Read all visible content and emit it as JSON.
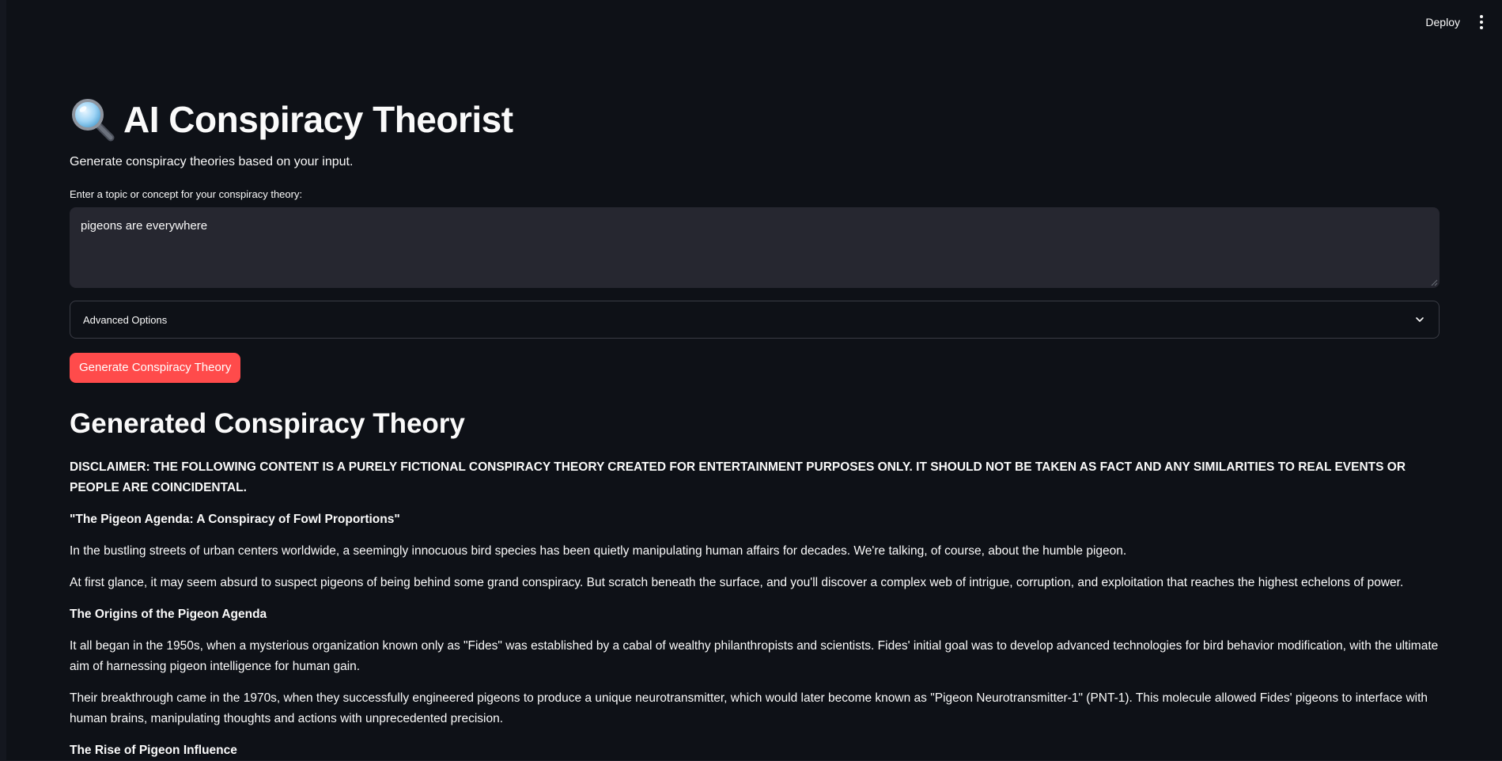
{
  "topbar": {
    "deploy_label": "Deploy"
  },
  "header": {
    "title": "AI Conspiracy Theorist",
    "subtitle": "Generate conspiracy theories based on your input."
  },
  "form": {
    "input_label": "Enter a topic or concept for your conspiracy theory:",
    "input_value": "pigeons are everywhere",
    "advanced_label": "Advanced Options",
    "generate_label": "Generate Conspiracy Theory"
  },
  "result": {
    "heading": "Generated Conspiracy Theory",
    "disclaimer": "DISCLAIMER: THE FOLLOWING CONTENT IS A PURELY FICTIONAL CONSPIRACY THEORY CREATED FOR ENTERTAINMENT PURPOSES ONLY. IT SHOULD NOT BE TAKEN AS FACT AND ANY SIMILARITIES TO REAL EVENTS OR PEOPLE ARE COINCIDENTAL.",
    "story_title": "\"The Pigeon Agenda: A Conspiracy of Fowl Proportions\"",
    "p1": "In the bustling streets of urban centers worldwide, a seemingly innocuous bird species has been quietly manipulating human affairs for decades. We're talking, of course, about the humble pigeon.",
    "p2": "At first glance, it may seem absurd to suspect pigeons of being behind some grand conspiracy. But scratch beneath the surface, and you'll discover a complex web of intrigue, corruption, and exploitation that reaches the highest echelons of power.",
    "h_origins": "The Origins of the Pigeon Agenda",
    "p3": "It all began in the 1950s, when a mysterious organization known only as \"Fides\" was established by a cabal of wealthy philanthropists and scientists. Fides' initial goal was to develop advanced technologies for bird behavior modification, with the ultimate aim of harnessing pigeon intelligence for human gain.",
    "p4": "Their breakthrough came in the 1970s, when they successfully engineered pigeons to produce a unique neurotransmitter, which would later become known as \"Pigeon Neurotransmitter-1\" (PNT-1). This molecule allowed Fides' pigeons to interface with human brains, manipulating thoughts and actions with unprecedented precision.",
    "h_rise": "The Rise of Pigeon Influence"
  },
  "colors": {
    "background": "#0e1117",
    "input_background": "#262730",
    "primary_button": "#ff4b4b",
    "text": "#fafafa"
  },
  "icons": {
    "title_icon": "magnifying-glass-icon",
    "menu_icon": "vertical-dots-icon",
    "expander_icon": "chevron-down-icon"
  }
}
